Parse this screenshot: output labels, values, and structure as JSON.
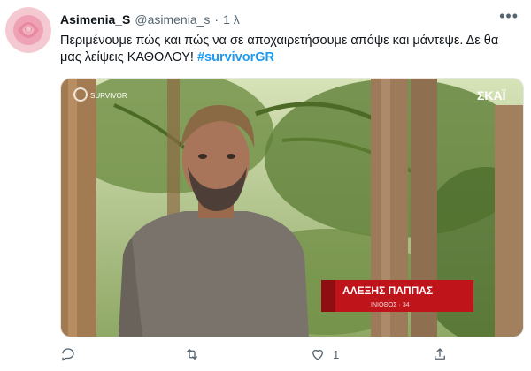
{
  "user": {
    "display_name": "Asimenia_S",
    "handle": "@asimenia_s",
    "separator": "·",
    "time": "1 λ"
  },
  "more_icon": "more-dots-icon",
  "tweet": {
    "text": "Περιμένουμε πώς και πώς να σε αποχαιρετήσουμε απόψε και μάντεψε. Δε θα μας λείψεις ΚΑΘΟΛΟΥ! ",
    "hashtag": "#survivorGR"
  },
  "media": {
    "channel_logo": "ΣΚΑΪ",
    "caption_name": "ΑΛΕΞΗΣ ΠΑΠΠΑΣ",
    "caption_sub": "ΙΝΙΟΘΟΣ · 34",
    "overlay_logo": "SURVIVOR"
  },
  "actions": {
    "reply_icon": "reply-icon",
    "retweet_icon": "retweet-icon",
    "like_icon": "heart-icon",
    "like_count": "1",
    "share_icon": "share-icon"
  },
  "colors": {
    "link": "#1d9bf0",
    "muted": "#536471",
    "caption_red": "#c0141b"
  }
}
